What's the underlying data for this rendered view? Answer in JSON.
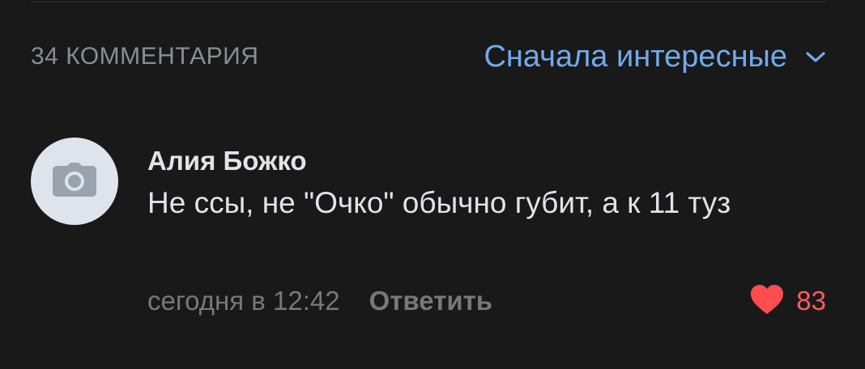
{
  "comments_header": {
    "count_label": "34 КОММЕНТАРИЯ",
    "sort_label": "Сначала интересные"
  },
  "comment": {
    "author": "Алия Божко",
    "text": "Не ссы, не \"Очко\" обычно губит, а к 11 туз",
    "timestamp": "сегодня в 12:42",
    "reply_label": "Ответить",
    "likes": "83",
    "avatar_icon": "camera-icon",
    "like_icon": "heart-icon"
  },
  "colors": {
    "background": "#19191a",
    "accent": "#71aaeb",
    "like": "#ff4d4d",
    "muted": "#76787a",
    "text": "#e1e3e6"
  }
}
